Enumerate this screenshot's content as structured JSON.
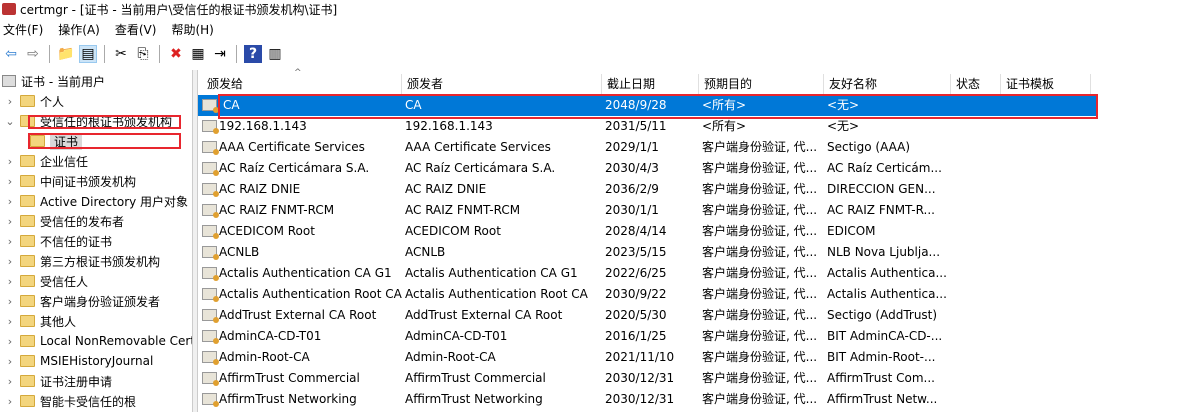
{
  "window": {
    "title": "certmgr - [证书 - 当前用户\\受信任的根证书颁发机构\\证书]"
  },
  "menu": [
    "文件(F)",
    "操作(A)",
    "查看(V)",
    "帮助(H)"
  ],
  "toolbar": [
    {
      "icon": "back-arrow-icon",
      "glyph": "⇦"
    },
    {
      "icon": "forward-arrow-icon",
      "glyph": "⇨"
    },
    {
      "icon": "up-folder-icon",
      "glyph": "📁"
    },
    {
      "icon": "show-hide-tree-icon",
      "glyph": "▤"
    },
    {
      "icon": "cut-icon",
      "glyph": "✂"
    },
    {
      "icon": "copy-icon",
      "glyph": "⎘"
    },
    {
      "icon": "delete-icon",
      "glyph": "✖"
    },
    {
      "icon": "properties-icon",
      "glyph": "▦"
    },
    {
      "icon": "export-icon",
      "glyph": "⇥"
    },
    {
      "icon": "help-icon",
      "glyph": "?"
    },
    {
      "icon": "action-pane-icon",
      "glyph": "▥"
    }
  ],
  "tree": {
    "root": "证书 - 当前用户",
    "items": [
      {
        "label": "个人",
        "level": 1,
        "expanded": false
      },
      {
        "label": "受信任的根证书颁发机构",
        "level": 1,
        "expanded": true
      },
      {
        "label": "证书",
        "level": 2,
        "selected": true
      },
      {
        "label": "企业信任",
        "level": 1
      },
      {
        "label": "中间证书颁发机构",
        "level": 1
      },
      {
        "label": "Active Directory 用户对象",
        "level": 1
      },
      {
        "label": "受信任的发布者",
        "level": 1
      },
      {
        "label": "不信任的证书",
        "level": 1
      },
      {
        "label": "第三方根证书颁发机构",
        "level": 1
      },
      {
        "label": "受信任人",
        "level": 1
      },
      {
        "label": "客户端身份验证颁发者",
        "level": 1
      },
      {
        "label": "其他人",
        "level": 1
      },
      {
        "label": "Local NonRemovable Certificates",
        "level": 1
      },
      {
        "label": "MSIEHistoryJournal",
        "level": 1
      },
      {
        "label": "证书注册申请",
        "level": 1
      },
      {
        "label": "智能卡受信任的根",
        "level": 1
      }
    ]
  },
  "columns": [
    "颁发给",
    "颁发者",
    "截止日期",
    "预期目的",
    "友好名称",
    "状态",
    "证书模板"
  ],
  "rows": [
    [
      "CA",
      "CA",
      "2048/9/28",
      "<所有>",
      "<无>"
    ],
    [
      "192.168.1.143",
      "192.168.1.143",
      "2031/5/11",
      "<所有>",
      "<无>"
    ],
    [
      "AAA Certificate Services",
      "AAA Certificate Services",
      "2029/1/1",
      "客户端身份验证, 代...",
      "Sectigo (AAA)"
    ],
    [
      "AC Raíz Certicámara S.A.",
      "AC Raíz Certicámara S.A.",
      "2030/4/3",
      "客户端身份验证, 代...",
      "AC Raíz Certicám..."
    ],
    [
      "AC RAIZ DNIE",
      "AC RAIZ DNIE",
      "2036/2/9",
      "客户端身份验证, 代...",
      "DIRECCION GEN..."
    ],
    [
      "AC RAIZ FNMT-RCM",
      "AC RAIZ FNMT-RCM",
      "2030/1/1",
      "客户端身份验证, 代...",
      "AC RAIZ FNMT-R..."
    ],
    [
      "ACEDICOM Root",
      "ACEDICOM Root",
      "2028/4/14",
      "客户端身份验证, 代...",
      "EDICOM"
    ],
    [
      "ACNLB",
      "ACNLB",
      "2023/5/15",
      "客户端身份验证, 代...",
      "NLB Nova Ljublja..."
    ],
    [
      "Actalis Authentication CA G1",
      "Actalis Authentication CA G1",
      "2022/6/25",
      "客户端身份验证, 代...",
      "Actalis Authentica..."
    ],
    [
      "Actalis Authentication Root CA",
      "Actalis Authentication Root CA",
      "2030/9/22",
      "客户端身份验证, 代...",
      "Actalis Authentica..."
    ],
    [
      "AddTrust External CA Root",
      "AddTrust External CA Root",
      "2020/5/30",
      "客户端身份验证, 代...",
      "Sectigo (AddTrust)"
    ],
    [
      "AdminCA-CD-T01",
      "AdminCA-CD-T01",
      "2016/1/25",
      "客户端身份验证, 代...",
      "BIT AdminCA-CD-..."
    ],
    [
      "Admin-Root-CA",
      "Admin-Root-CA",
      "2021/11/10",
      "客户端身份验证, 代...",
      "BIT Admin-Root-..."
    ],
    [
      "AffirmTrust Commercial",
      "AffirmTrust Commercial",
      "2030/12/31",
      "客户端身份验证, 代...",
      "AffirmTrust Com..."
    ],
    [
      "AffirmTrust Networking",
      "AffirmTrust Networking",
      "2030/12/31",
      "客户端身份验证, 代...",
      "AffirmTrust Netw..."
    ]
  ],
  "colors": {
    "selection": "#0078d7",
    "highlight_box": "#e8262e"
  }
}
